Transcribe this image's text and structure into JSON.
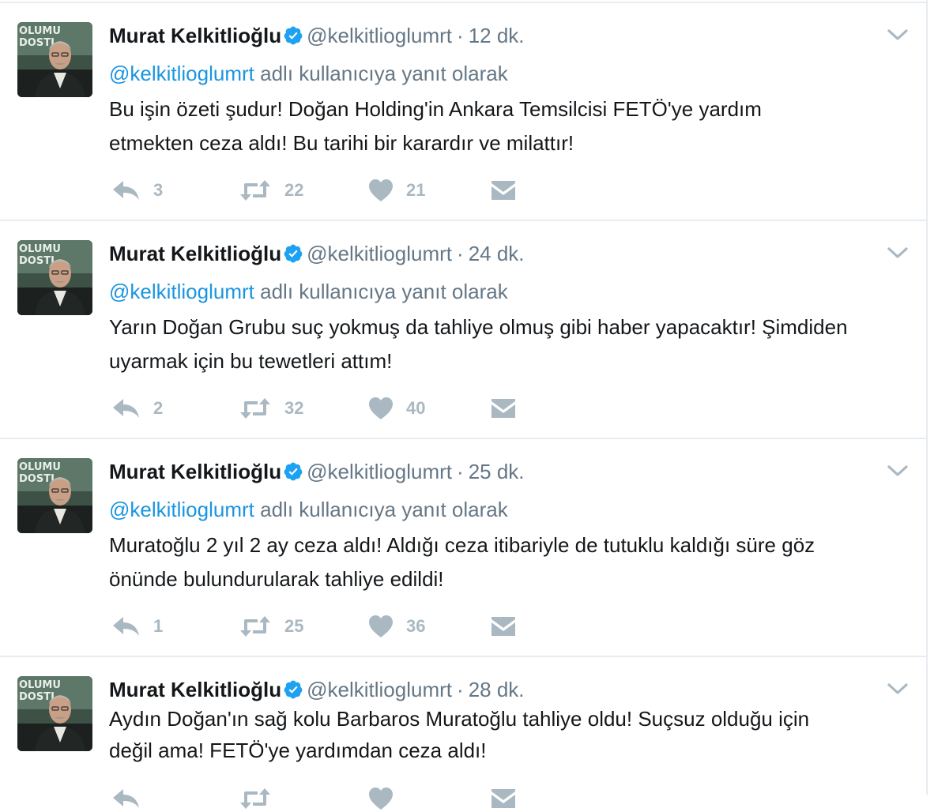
{
  "colors": {
    "text": "#14171a",
    "muted": "#657786",
    "link": "#1b95e0",
    "action": "#aab8c2",
    "verified": "#1da1f2"
  },
  "avatar_text": [
    "OLUMU",
    "DOSTL"
  ],
  "tweets": [
    {
      "name": "Murat Kelkitlioğlu",
      "handle": "@kelkitlioglumrt",
      "separator": "·",
      "time": "12 dk.",
      "reply_mention": "@kelkitlioglumrt",
      "reply_suffix": "adlı kullanıcıya yanıt olarak",
      "lines": [
        "Bu işin özeti şudur! Doğan Holding'in Ankara Temsilcisi FETÖ'ye yardım",
        "etmekten ceza aldı! Bu tarihi bir karardır ve milattır!"
      ],
      "replies": "3",
      "retweets": "22",
      "likes": "21"
    },
    {
      "name": "Murat Kelkitlioğlu",
      "handle": "@kelkitlioglumrt",
      "separator": "·",
      "time": "24 dk.",
      "reply_mention": "@kelkitlioglumrt",
      "reply_suffix": "adlı kullanıcıya yanıt olarak",
      "lines": [
        "Yarın Doğan Grubu suç yokmuş da tahliye olmuş gibi haber yapacaktır! Şimdiden",
        "uyarmak için bu tewetleri attım!"
      ],
      "replies": "2",
      "retweets": "32",
      "likes": "40"
    },
    {
      "name": "Murat Kelkitlioğlu",
      "handle": "@kelkitlioglumrt",
      "separator": "·",
      "time": "25 dk.",
      "reply_mention": "@kelkitlioglumrt",
      "reply_suffix": "adlı kullanıcıya yanıt olarak",
      "lines": [
        "Muratoğlu 2 yıl 2 ay ceza aldı! Aldığı ceza itibariyle de tutuklu kaldığı süre göz",
        "önünde bulundurularak tahliye edildi!"
      ],
      "replies": "1",
      "retweets": "25",
      "likes": "36"
    },
    {
      "name": "Murat Kelkitlioğlu",
      "handle": "@kelkitlioglumrt",
      "separator": "·",
      "time": "28 dk.",
      "lines": [
        "Aydın Doğan'ın sağ kolu Barbaros Muratoğlu tahliye oldu! Suçsuz olduğu için",
        "değil ama! FETÖ'ye yardımdan ceza aldı!"
      ]
    }
  ]
}
